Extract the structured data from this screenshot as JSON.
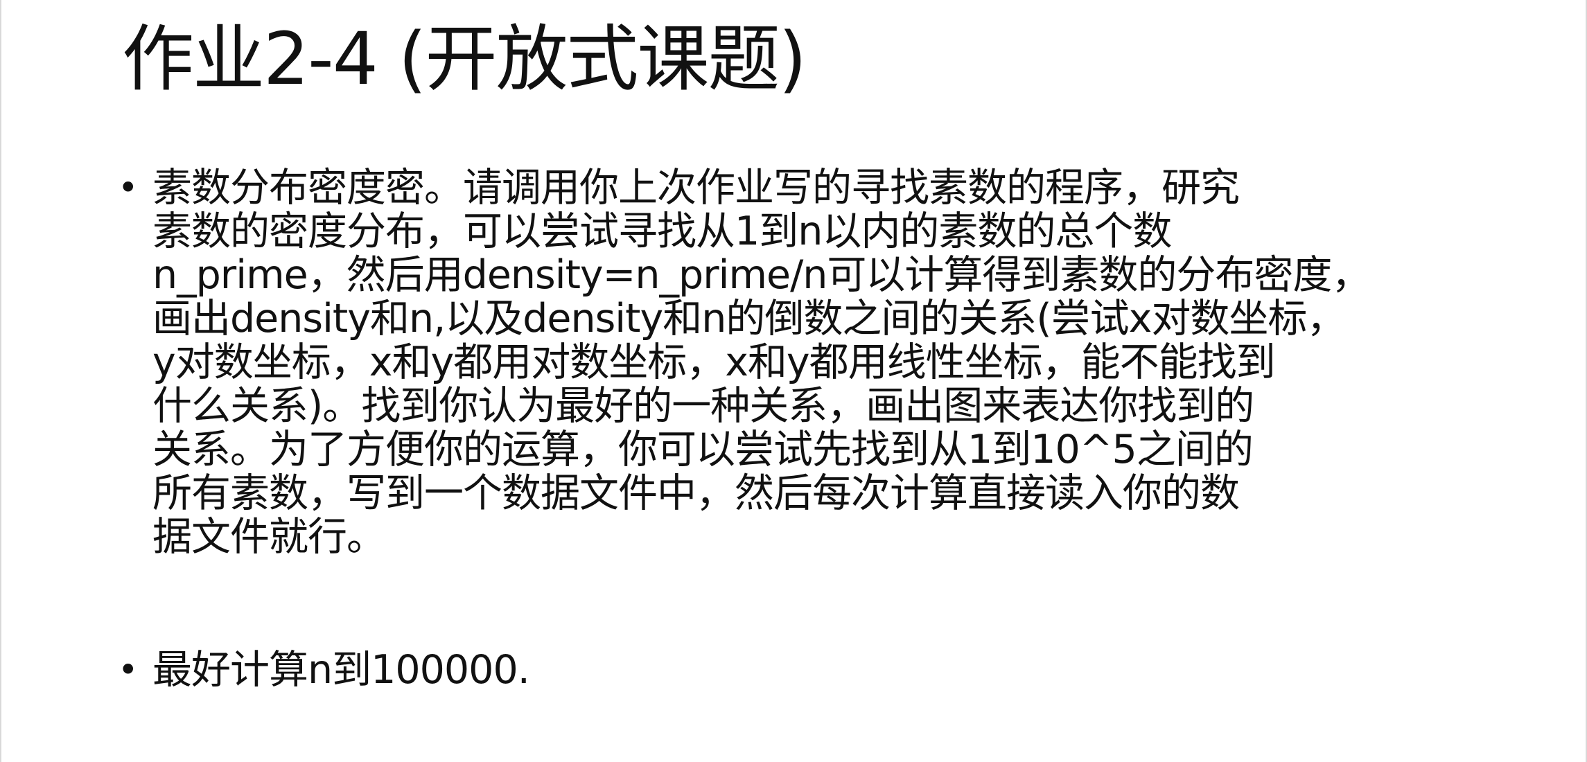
{
  "slide": {
    "title": "作业2-4 (开放式课题)",
    "bullets": [
      {
        "lines": [
          "素数分布密度密。请调用你上次作业写的寻找素数的程序，研究",
          "素数的密度分布，可以尝试寻找从1到n以内的素数的总个数",
          "n_prime，然后用density=n_prime/n可以计算得到素数的分布密度，",
          "画出density和n,以及density和n的倒数之间的关系(尝试x对数坐标，",
          "y对数坐标，x和y都用对数坐标，x和y都用线性坐标，能不能找到",
          "什么关系)。找到你认为最好的一种关系，画出图来表达你找到的",
          "关系。为了方便你的运算，你可以尝试先找到从1到10^5之间的",
          "所有素数，写到一个数据文件中，然后每次计算直接读入你的数",
          "据文件就行。"
        ]
      },
      {
        "lines": [
          "最好计算n到100000."
        ]
      }
    ],
    "bullet_glyph": "•"
  }
}
